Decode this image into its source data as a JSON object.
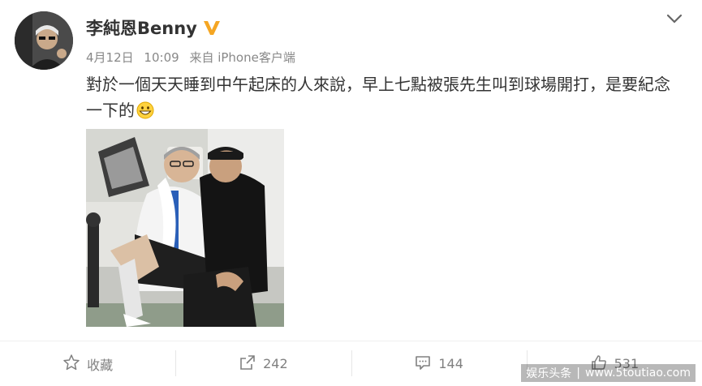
{
  "post": {
    "author": "李純恩Benny",
    "verified_icon": "verified-v-icon",
    "date": "4月12日",
    "time": "10:09",
    "source": "来自 iPhone客户端",
    "text": "對於一個天天睡到中午起床的人來說，早上七點被張先生叫到球場開打，是要紀念一下的",
    "emoji": "grinning-face-emoji"
  },
  "actions": [
    {
      "icon": "star-icon",
      "label": "收藏"
    },
    {
      "icon": "share-icon",
      "label": "242"
    },
    {
      "icon": "comment-icon",
      "label": "144"
    },
    {
      "icon": "thumbs-up-icon",
      "label": "531"
    }
  ],
  "watermark": {
    "brand": "娱乐头条",
    "url": "www.5toutiao.com"
  },
  "colors": {
    "text": "#333333",
    "meta": "#888888",
    "verified": "#f5a623",
    "action_text": "#808080"
  }
}
